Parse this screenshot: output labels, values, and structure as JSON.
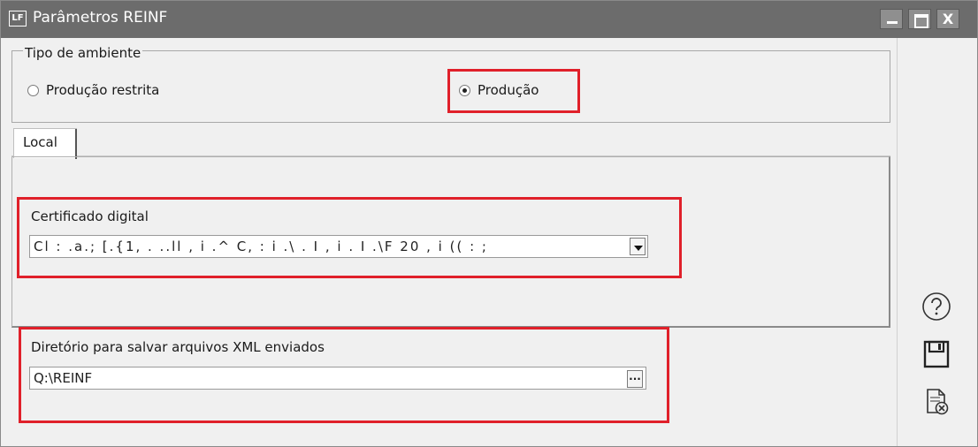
{
  "window": {
    "title": "Parâmetros REINF",
    "icon_label": "LF",
    "close_glyph": "X"
  },
  "environment": {
    "legend": "Tipo de ambiente",
    "options": [
      {
        "label": "Produção restrita",
        "selected": false
      },
      {
        "label": "Produção",
        "selected": true
      }
    ]
  },
  "tabs": [
    {
      "label": "Local",
      "active": true
    }
  ],
  "certificate": {
    "label": "Certificado digital",
    "value": "Cl : .a.; [.{1, . ..ll , i .^ C, : i .\\ . I , i . I .\\F 20 , i (( : ;"
  },
  "xml_directory": {
    "label": "Diretório para salvar arquivos XML enviados",
    "value": "Q:\\REINF",
    "browse_glyph": "..."
  },
  "side_actions": [
    {
      "name": "help-icon"
    },
    {
      "name": "save-icon"
    },
    {
      "name": "cancel-document-icon"
    }
  ],
  "colors": {
    "highlight": "#e0202a",
    "titlebar": "#6c6c6c"
  }
}
